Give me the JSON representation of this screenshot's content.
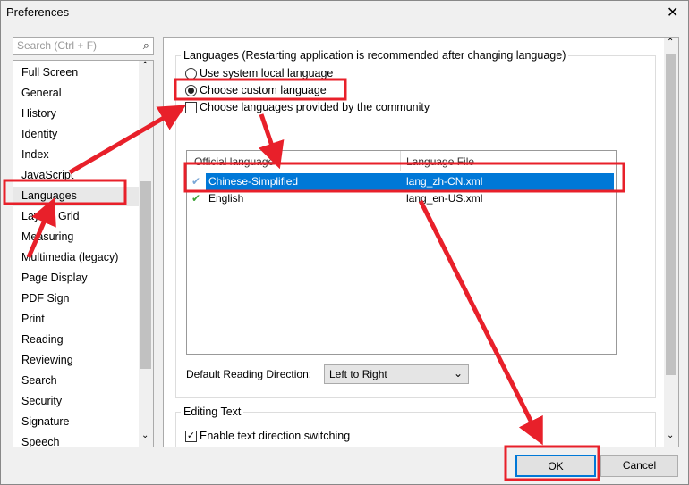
{
  "window": {
    "title": "Preferences",
    "close_icon": "close-icon"
  },
  "sidebar": {
    "search_placeholder": "Search (Ctrl + F)",
    "selected": "Languages",
    "items": [
      "Full Screen",
      "General",
      "History",
      "Identity",
      "Index",
      "JavaScript",
      "Languages",
      "Layout Grid",
      "Measuring",
      "Multimedia (legacy)",
      "Page Display",
      "PDF Sign",
      "Print",
      "Reading",
      "Reviewing",
      "Search",
      "Security",
      "Signature",
      "Speech"
    ]
  },
  "languages": {
    "group_label": "Languages (Restarting application is recommended after changing language)",
    "option_system": "Use system local language",
    "option_custom": "Choose custom language",
    "selected_option": "custom",
    "community_label": "Choose languages provided by the community",
    "community_checked": false,
    "table": {
      "headers": [
        "Official language",
        "Language File"
      ],
      "rows": [
        {
          "language": "Chinese-Simplified",
          "file": "lang_zh-CN.xml",
          "selected": true
        },
        {
          "language": "English",
          "file": "lang_en-US.xml",
          "selected": false
        }
      ]
    },
    "reading_direction_label": "Default Reading Direction:",
    "reading_direction_value": "Left to Right"
  },
  "editing": {
    "group_label": "Editing Text",
    "text_direction_label": "Enable text direction switching",
    "text_direction_checked": true
  },
  "buttons": {
    "ok": "OK",
    "cancel": "Cancel"
  },
  "colors": {
    "selection": "#0078d7",
    "annotation": "#e8202a",
    "check": "#3aa335"
  }
}
